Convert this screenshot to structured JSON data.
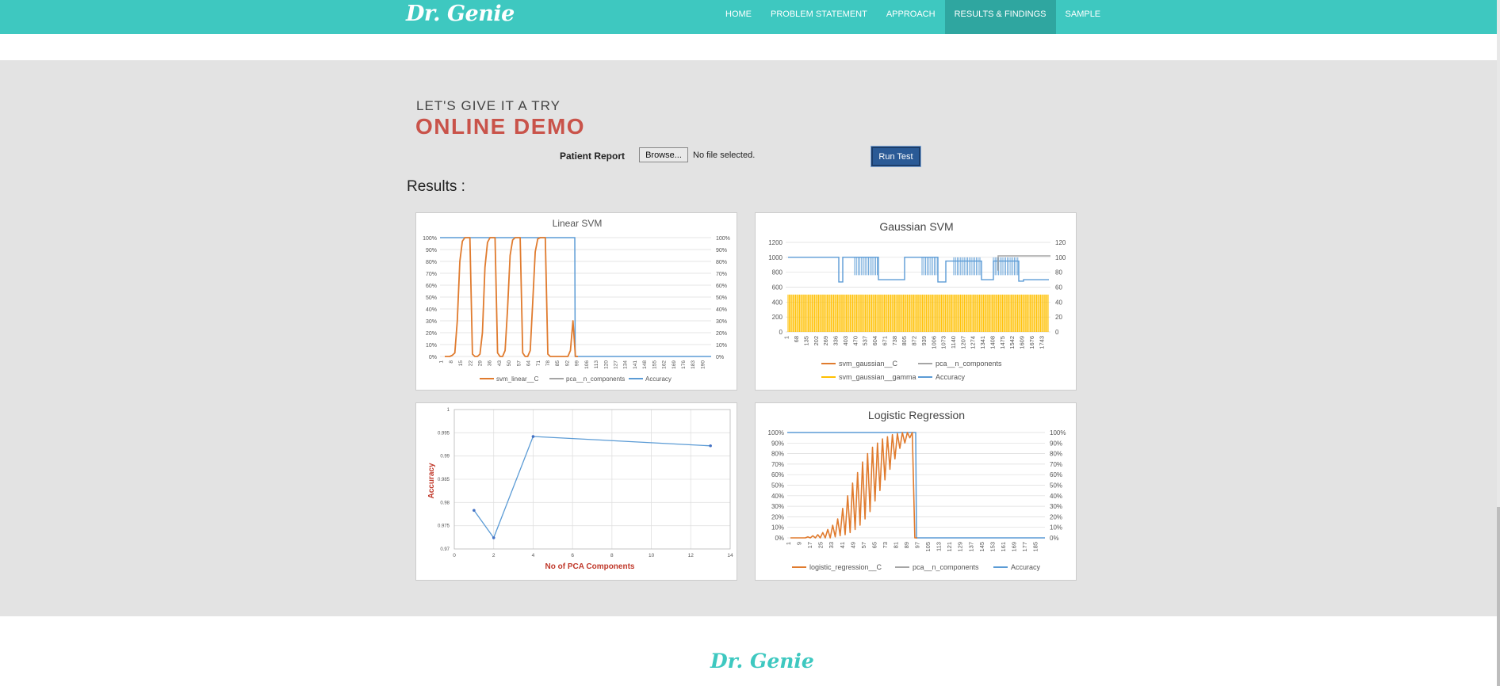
{
  "brand": {
    "logo_text": "Dr. Genie",
    "footer_logo_text": "Dr. Genie"
  },
  "nav": {
    "items": [
      {
        "label": "HOME",
        "active": false
      },
      {
        "label": "PROBLEM STATEMENT",
        "active": false
      },
      {
        "label": "APPROACH",
        "active": false
      },
      {
        "label": "RESULTS & FINDINGS",
        "active": true
      },
      {
        "label": "SAMPLE",
        "active": false
      }
    ]
  },
  "demo": {
    "kicker": "LET'S GIVE IT A TRY",
    "heading": "ONLINE DEMO",
    "report_label": "Patient Report",
    "browse_label": "Browse...",
    "file_status": "No file selected.",
    "run_label": "Run Test"
  },
  "results_title": "Results :",
  "colors": {
    "teal": "#3ec8c0",
    "heading_red": "#c9534a",
    "orange": "#e07b2e",
    "blue": "#5b9bd5",
    "gray": "#a5a5a5",
    "yellow": "#ffc000"
  },
  "chart_data": [
    {
      "type": "line",
      "title": "Linear SVM",
      "left_ticks": [
        "0%",
        "10%",
        "20%",
        "30%",
        "40%",
        "50%",
        "60%",
        "70%",
        "80%",
        "90%",
        "100%"
      ],
      "right_ticks": [
        "0%",
        "10%",
        "20%",
        "30%",
        "40%",
        "50%",
        "60%",
        "70%",
        "80%",
        "90%",
        "100%"
      ],
      "x_ticks": [
        "1",
        "8",
        "15",
        "22",
        "29",
        "36",
        "43",
        "50",
        "57",
        "64",
        "71",
        "78",
        "85",
        "92",
        "99",
        "106",
        "113",
        "120",
        "127",
        "134",
        "141",
        "148",
        "155",
        "162",
        "169",
        "176",
        "183",
        "190"
      ],
      "series": [
        {
          "name": "svm_linear__C",
          "color": "#e07b2e",
          "values": [
            0,
            0,
            0,
            1,
            3,
            30,
            80,
            97,
            100,
            100,
            100,
            2,
            0,
            0,
            2,
            20,
            75,
            96,
            100,
            100,
            100,
            3,
            0,
            0,
            5,
            40,
            85,
            98,
            100,
            100,
            100,
            3,
            0,
            0,
            5,
            45,
            88,
            99,
            100,
            100,
            100,
            2,
            0,
            0,
            0,
            0,
            0,
            0,
            0,
            0,
            5,
            30,
            0,
            0
          ]
        },
        {
          "name": "pca__n_components",
          "color": "#a5a5a5",
          "values": []
        },
        {
          "name": "Accuracy",
          "color": "#5b9bd5",
          "values": [
            100,
            100,
            0,
            0
          ]
        }
      ],
      "legend": "bottom"
    },
    {
      "type": "line",
      "title": "Gaussian SVM",
      "left_ticks": [
        "0",
        "200",
        "400",
        "600",
        "800",
        "1000",
        "1200"
      ],
      "right_ticks": [
        "0",
        "20",
        "40",
        "60",
        "80",
        "100",
        "120"
      ],
      "x_ticks": [
        "1",
        "68",
        "135",
        "202",
        "269",
        "336",
        "403",
        "470",
        "537",
        "604",
        "671",
        "738",
        "805",
        "872",
        "939",
        "1006",
        "1073",
        "1140",
        "1207",
        "1274",
        "1341",
        "1408",
        "1475",
        "1542",
        "1609",
        "1676",
        "1743"
      ],
      "series": [
        {
          "name": "svm_gaussian__C",
          "color": "#e07b2e",
          "values": []
        },
        {
          "name": "pca__n_components",
          "color": "#a5a5a5",
          "values": [
            100,
            100
          ]
        },
        {
          "name": "svm_gaussian__gamma",
          "color": "#ffc000",
          "values": [
            500,
            0
          ]
        },
        {
          "name": "Accuracy",
          "color": "#5b9bd5",
          "values": [
            1000,
            670
          ]
        }
      ],
      "legend": "bottom"
    },
    {
      "type": "scatter",
      "title": "",
      "xlabel": "No of PCA Components",
      "ylabel": "Accuracy",
      "x_ticks": [
        "0",
        "2",
        "4",
        "6",
        "8",
        "10",
        "12",
        "14"
      ],
      "y_ticks": [
        "0.97",
        "0.975",
        "0.98",
        "0.985",
        "0.99",
        "0.995",
        "1"
      ],
      "xlim": [
        0,
        14
      ],
      "ylim": [
        0.97,
        1
      ],
      "points": [
        {
          "x": 1,
          "y": 0.9783
        },
        {
          "x": 2,
          "y": 0.9724
        },
        {
          "x": 4,
          "y": 0.9942
        },
        {
          "x": 13,
          "y": 0.9922
        }
      ]
    },
    {
      "type": "line",
      "title": "Logistic Regression",
      "left_ticks": [
        "0%",
        "10%",
        "20%",
        "30%",
        "40%",
        "50%",
        "60%",
        "70%",
        "80%",
        "90%",
        "100%"
      ],
      "right_ticks": [
        "0%",
        "10%",
        "20%",
        "30%",
        "40%",
        "50%",
        "60%",
        "70%",
        "80%",
        "90%",
        "100%"
      ],
      "x_ticks": [
        "1",
        "9",
        "17",
        "25",
        "33",
        "41",
        "49",
        "57",
        "65",
        "73",
        "81",
        "89",
        "97",
        "105",
        "113",
        "121",
        "129",
        "137",
        "145",
        "153",
        "161",
        "169",
        "177",
        "185"
      ],
      "series": [
        {
          "name": "logistic_regression__C",
          "color": "#e07b2e",
          "values": [
            0,
            0,
            0,
            0,
            0,
            0,
            0,
            1,
            0,
            2,
            0,
            3,
            0,
            5,
            0,
            8,
            0,
            12,
            1,
            18,
            2,
            28,
            3,
            40,
            5,
            52,
            8,
            62,
            12,
            72,
            18,
            80,
            25,
            86,
            35,
            90,
            45,
            94,
            55,
            96,
            65,
            98,
            75,
            99,
            85,
            100,
            90,
            100,
            95,
            100,
            0,
            0
          ]
        },
        {
          "name": "pca__n_components",
          "color": "#a5a5a5",
          "values": []
        },
        {
          "name": "Accuracy",
          "color": "#5b9bd5",
          "values": [
            100,
            100,
            0,
            0
          ]
        }
      ],
      "legend": "bottom"
    }
  ]
}
